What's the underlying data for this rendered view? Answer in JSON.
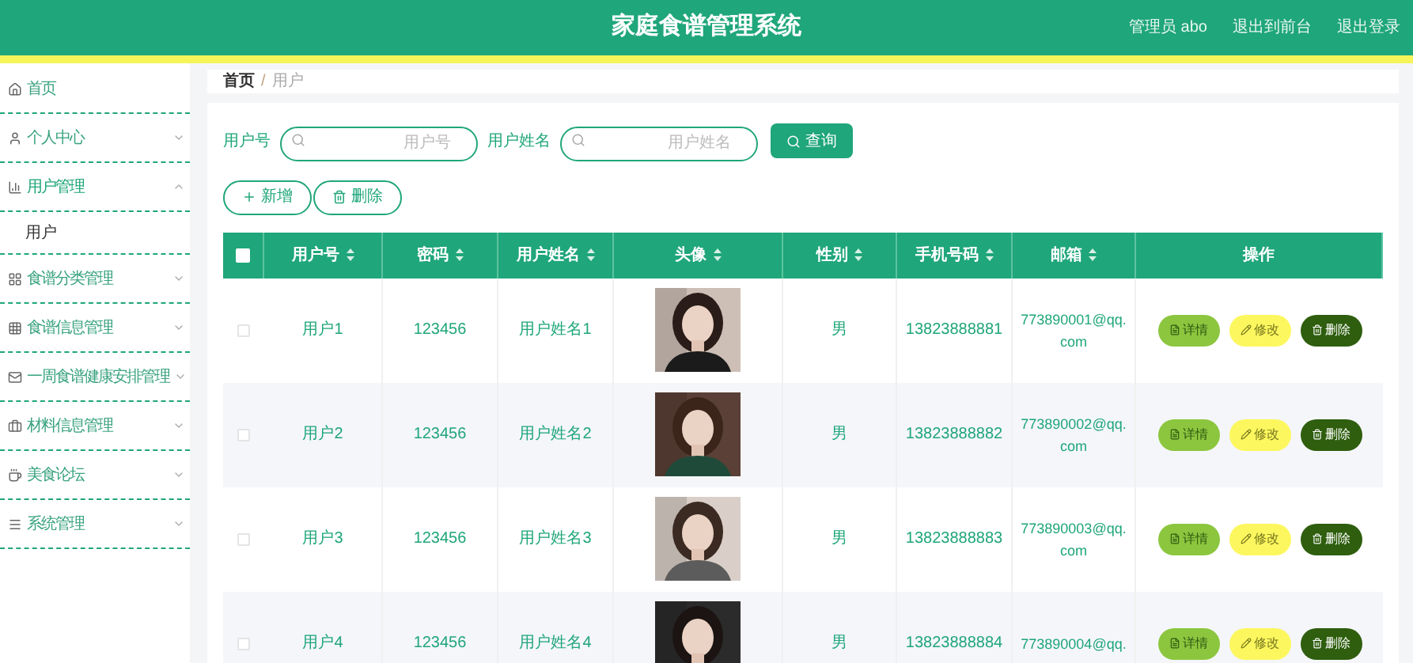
{
  "header": {
    "title": "家庭食谱管理系统",
    "links": [
      "管理员 abo",
      "退出到前台",
      "退出登录"
    ]
  },
  "sidebar": {
    "items": [
      {
        "label": "首页",
        "kind": "home",
        "expandable": false,
        "expanded": false
      },
      {
        "label": "个人中心",
        "kind": "user",
        "expandable": true,
        "expanded": false
      },
      {
        "label": "用户管理",
        "kind": "chart",
        "expandable": true,
        "expanded": true,
        "children": [
          {
            "label": "用户"
          }
        ]
      },
      {
        "label": "食谱分类管理",
        "kind": "grid",
        "expandable": true,
        "expanded": false
      },
      {
        "label": "食谱信息管理",
        "kind": "table",
        "expandable": true,
        "expanded": false
      },
      {
        "label": "一周食谱健康安排管理",
        "kind": "mail",
        "expandable": true,
        "expanded": false
      },
      {
        "label": "材料信息管理",
        "kind": "box",
        "expandable": true,
        "expanded": false
      },
      {
        "label": "美食论坛",
        "kind": "cup",
        "expandable": true,
        "expanded": false
      },
      {
        "label": "系统管理",
        "kind": "list",
        "expandable": true,
        "expanded": false
      }
    ]
  },
  "breadcrumb": {
    "items": [
      "首页",
      "用户"
    ],
    "separator": "/"
  },
  "search": {
    "fields": [
      {
        "label": "用户号",
        "placeholder": "用户号"
      },
      {
        "label": "用户姓名",
        "placeholder": "用户姓名"
      }
    ],
    "button": "查询"
  },
  "actions": [
    {
      "label": "新增",
      "kind": "add"
    },
    {
      "label": "删除",
      "kind": "delete"
    }
  ],
  "table": {
    "all_selected": false,
    "columns": [
      "用户号",
      "密码",
      "用户姓名",
      "头像",
      "性别",
      "手机号码",
      "邮箱",
      "操作"
    ],
    "rows": [
      {
        "selected": false,
        "cells": [
          "用户1",
          "123456",
          "用户姓名1",
          "",
          "男",
          "13823888881",
          "773890001@qq.com"
        ],
        "actions": [
          {
            "label": "详情",
            "kind": "detail"
          },
          {
            "label": "修改",
            "kind": "edit"
          },
          {
            "label": "删除",
            "kind": "delete"
          }
        ]
      },
      {
        "selected": false,
        "cells": [
          "用户2",
          "123456",
          "用户姓名2",
          "",
          "男",
          "13823888882",
          "773890002@qq.com"
        ],
        "actions": [
          {
            "label": "详情",
            "kind": "detail"
          },
          {
            "label": "修改",
            "kind": "edit"
          },
          {
            "label": "删除",
            "kind": "delete"
          }
        ]
      },
      {
        "selected": false,
        "cells": [
          "用户3",
          "123456",
          "用户姓名3",
          "",
          "男",
          "13823888883",
          "773890003@qq.com"
        ],
        "actions": [
          {
            "label": "详情",
            "kind": "detail"
          },
          {
            "label": "修改",
            "kind": "edit"
          },
          {
            "label": "删除",
            "kind": "delete"
          }
        ]
      },
      {
        "selected": false,
        "cells": [
          "用户4",
          "123456",
          "用户姓名4",
          "",
          "男",
          "13823888884",
          "773890004@qq."
        ],
        "actions": [
          {
            "label": "详情",
            "kind": "detail"
          },
          {
            "label": "修改",
            "kind": "edit"
          },
          {
            "label": "删除",
            "kind": "delete"
          }
        ]
      }
    ]
  }
}
